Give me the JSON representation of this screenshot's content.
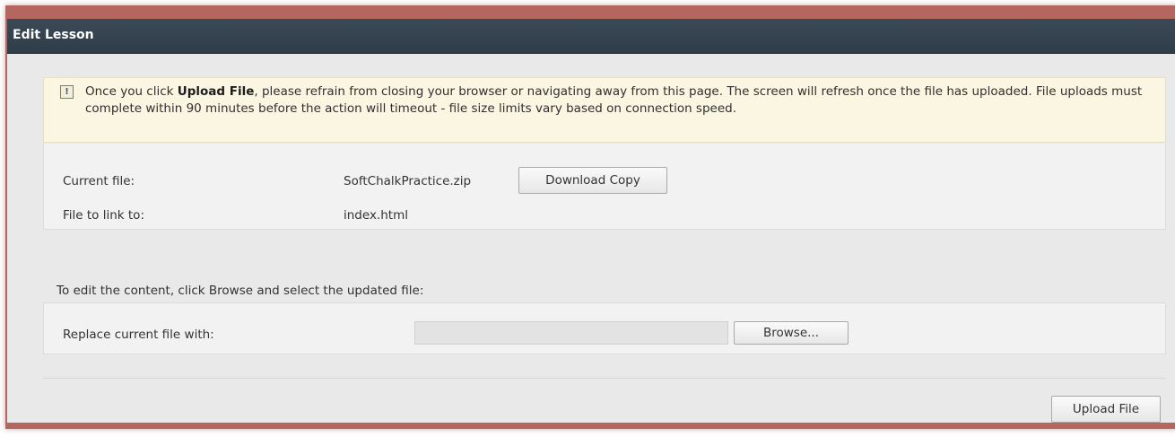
{
  "window": {
    "title": "Edit Lesson"
  },
  "notice": {
    "icon": "warning-icon",
    "text_before": "Once you click ",
    "text_bold": "Upload File",
    "text_after": ", please refrain from closing your browser or navigating away from this page. The screen will refresh once the file has uploaded. File uploads must complete within 90 minutes before the action will timeout - file size limits vary based on connection speed."
  },
  "file_info": {
    "current_file_label": "Current file:",
    "current_file_value": "SoftChalkPractice.zip",
    "download_label": "Download Copy",
    "link_label": "File to link to:",
    "link_value": "index.html"
  },
  "edit": {
    "instruction": "To edit the content, click Browse and select the updated file:",
    "replace_label": "Replace current file with:",
    "browse_label": "Browse...",
    "file_value": ""
  },
  "actions": {
    "upload_label": "Upload File"
  },
  "colors": {
    "title_bar": "#34444f",
    "frame": "#b5675f",
    "notice_bg": "#fbf6e2",
    "panel_bg": "#e9e9e9"
  }
}
